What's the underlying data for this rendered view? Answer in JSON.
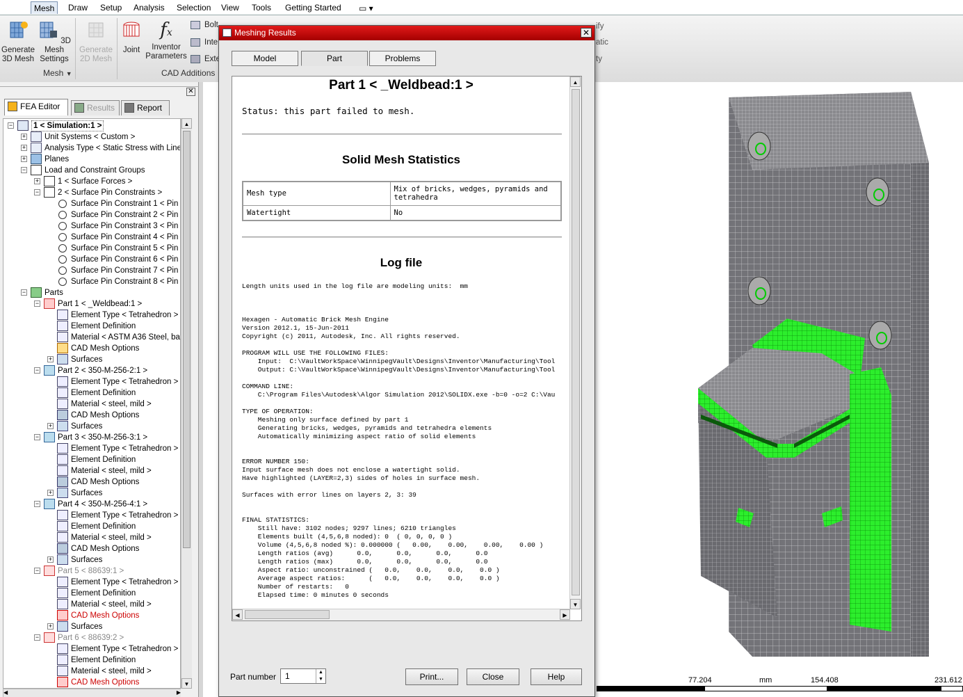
{
  "menu": {
    "items": [
      "Mesh",
      "Draw",
      "Setup",
      "Analysis",
      "Selection",
      "View",
      "Tools",
      "Getting Started"
    ],
    "active": "Mesh"
  },
  "ribbon": {
    "generate_3d_mesh": "Generate\n3D Mesh",
    "mesh_settings_3d": "3D Mesh\nSettings",
    "generate_2d_mesh": "Generate\n2D Mesh",
    "joint": "Joint",
    "inventor_parameters": "Inventor\nParameters",
    "group_mesh": "Mesh",
    "group_cad_additions": "CAD Additions",
    "bolt": "Bolt",
    "inte": "Inte",
    "exte": "Exte",
    "right_frag1": "ify",
    "right_frag2": "atic",
    "right_frag3": "ty"
  },
  "left_pane": {
    "tabs": [
      "FEA Editor",
      "Results",
      "Report"
    ],
    "active_tab": "FEA Editor",
    "tree": [
      {
        "level": 0,
        "exp": "-",
        "icon": "sim",
        "label": "1 < Simulation:1 >",
        "style": "bold"
      },
      {
        "level": 1,
        "exp": "+",
        "icon": "units",
        "label": "Unit Systems < Custom >"
      },
      {
        "level": 1,
        "exp": "+",
        "icon": "analysis",
        "label": "Analysis Type < Static Stress with Linear"
      },
      {
        "level": 1,
        "exp": "+",
        "icon": "planes",
        "label": "Planes"
      },
      {
        "level": 1,
        "exp": "-",
        "icon": "load",
        "label": "Load and Constraint Groups"
      },
      {
        "level": 2,
        "exp": "+",
        "icon": "load",
        "label": "1 < Surface Forces >"
      },
      {
        "level": 2,
        "exp": "-",
        "icon": "load",
        "label": "2 < Surface Pin Constraints >"
      },
      {
        "level": 3,
        "exp": "",
        "icon": "pin",
        "label": "Surface Pin Constraint 1 < Pin Co"
      },
      {
        "level": 3,
        "exp": "",
        "icon": "pin",
        "label": "Surface Pin Constraint 2 < Pin Co"
      },
      {
        "level": 3,
        "exp": "",
        "icon": "pin",
        "label": "Surface Pin Constraint 3 < Pin Co"
      },
      {
        "level": 3,
        "exp": "",
        "icon": "pin",
        "label": "Surface Pin Constraint 4 < Pin Co"
      },
      {
        "level": 3,
        "exp": "",
        "icon": "pin",
        "label": "Surface Pin Constraint 5 < Pin Co"
      },
      {
        "level": 3,
        "exp": "",
        "icon": "pin",
        "label": "Surface Pin Constraint 6 < Pin Co"
      },
      {
        "level": 3,
        "exp": "",
        "icon": "pin",
        "label": "Surface Pin Constraint 7 < Pin Co"
      },
      {
        "level": 3,
        "exp": "",
        "icon": "pin",
        "label": "Surface Pin Constraint 8 < Pin Co"
      },
      {
        "level": 1,
        "exp": "-",
        "icon": "parts",
        "label": "Parts"
      },
      {
        "level": 2,
        "exp": "-",
        "icon": "partwarn",
        "label": "Part 1 < _Weldbead:1 >"
      },
      {
        "level": 3,
        "exp": "",
        "icon": "doc",
        "label": "Element Type < Tetrahedron >"
      },
      {
        "level": 3,
        "exp": "",
        "icon": "doc",
        "label": "Element Definition"
      },
      {
        "level": 3,
        "exp": "",
        "icon": "doc",
        "label": "Material < ASTM A36 Steel, bar"
      },
      {
        "level": 3,
        "exp": "",
        "icon": "meshwarn",
        "label": "CAD Mesh Options"
      },
      {
        "level": 3,
        "exp": "+",
        "icon": "surf",
        "label": "Surfaces"
      },
      {
        "level": 2,
        "exp": "-",
        "icon": "part",
        "label": "Part 2 < 350-M-256-2:1 >"
      },
      {
        "level": 3,
        "exp": "",
        "icon": "doc",
        "label": "Element Type < Tetrahedron >"
      },
      {
        "level": 3,
        "exp": "",
        "icon": "doc",
        "label": "Element Definition"
      },
      {
        "level": 3,
        "exp": "",
        "icon": "doc",
        "label": "Material < steel, mild >"
      },
      {
        "level": 3,
        "exp": "",
        "icon": "mesh",
        "label": "CAD Mesh Options"
      },
      {
        "level": 3,
        "exp": "+",
        "icon": "surf",
        "label": "Surfaces"
      },
      {
        "level": 2,
        "exp": "-",
        "icon": "part",
        "label": "Part 3 < 350-M-256-3:1 >"
      },
      {
        "level": 3,
        "exp": "",
        "icon": "doc",
        "label": "Element Type < Tetrahedron >"
      },
      {
        "level": 3,
        "exp": "",
        "icon": "doc",
        "label": "Element Definition"
      },
      {
        "level": 3,
        "exp": "",
        "icon": "doc",
        "label": "Material < steel, mild >"
      },
      {
        "level": 3,
        "exp": "",
        "icon": "mesh",
        "label": "CAD Mesh Options"
      },
      {
        "level": 3,
        "exp": "+",
        "icon": "surf",
        "label": "Surfaces"
      },
      {
        "level": 2,
        "exp": "-",
        "icon": "part",
        "label": "Part 4 < 350-M-256-4:1 >"
      },
      {
        "level": 3,
        "exp": "",
        "icon": "doc",
        "label": "Element Type < Tetrahedron >"
      },
      {
        "level": 3,
        "exp": "",
        "icon": "doc",
        "label": "Element Definition"
      },
      {
        "level": 3,
        "exp": "",
        "icon": "doc",
        "label": "Material < steel, mild >"
      },
      {
        "level": 3,
        "exp": "",
        "icon": "mesh",
        "label": "CAD Mesh Options"
      },
      {
        "level": 3,
        "exp": "+",
        "icon": "surf",
        "label": "Surfaces"
      },
      {
        "level": 2,
        "exp": "-",
        "icon": "partx",
        "label": "Part 5 < 88639:1 >",
        "style": "gray"
      },
      {
        "level": 3,
        "exp": "",
        "icon": "doc",
        "label": "Element Type < Tetrahedron >"
      },
      {
        "level": 3,
        "exp": "",
        "icon": "doc",
        "label": "Element Definition"
      },
      {
        "level": 3,
        "exp": "",
        "icon": "doc",
        "label": "Material < steel, mild >"
      },
      {
        "level": 3,
        "exp": "",
        "icon": "meshx",
        "label": "CAD Mesh Options",
        "style": "red"
      },
      {
        "level": 3,
        "exp": "+",
        "icon": "surf",
        "label": "Surfaces"
      },
      {
        "level": 2,
        "exp": "-",
        "icon": "partx",
        "label": "Part 6 < 88639:2 >",
        "style": "gray"
      },
      {
        "level": 3,
        "exp": "",
        "icon": "doc",
        "label": "Element Type < Tetrahedron >"
      },
      {
        "level": 3,
        "exp": "",
        "icon": "doc",
        "label": "Element Definition"
      },
      {
        "level": 3,
        "exp": "",
        "icon": "doc",
        "label": "Material < steel, mild >"
      },
      {
        "level": 3,
        "exp": "",
        "icon": "meshx",
        "label": "CAD Mesh Options",
        "style": "red"
      }
    ]
  },
  "dialog": {
    "title": "Meshing Results",
    "close": "✕",
    "tabs": [
      "Model",
      "Part",
      "Problems"
    ],
    "active_tab": "Part",
    "report": {
      "heading": "Part 1 < _Weldbead:1 >",
      "status": "Status: this part failed to mesh.",
      "stats_heading": "Solid Mesh Statistics",
      "stats": [
        {
          "key": "Mesh type",
          "value": "Mix of bricks, wedges, pyramids and tetrahedra"
        },
        {
          "key": "Watertight",
          "value": "No"
        }
      ],
      "log_heading": "Log file",
      "log_text": "Length units used in the log file are modeling units:  mm\n\n\n\nHexagen - Automatic Brick Mesh Engine\nVersion 2012.1, 15-Jun-2011\nCopyright (c) 2011, Autodesk, Inc. All rights reserved.\n\nPROGRAM WILL USE THE FOLLOWING FILES:\n    Input:  C:\\VaultWorkSpace\\WinnipegVault\\Designs\\Inventor\\Manufacturing\\Tool\n    Output: C:\\VaultWorkSpace\\WinnipegVault\\Designs\\Inventor\\Manufacturing\\Tool\n\nCOMMAND LINE:\n    C:\\Program Files\\Autodesk\\Algor Simulation 2012\\SOLIDX.exe -b=0 -o=2 C:\\Vau\n\nTYPE OF OPERATION:\n    Meshing only surface defined by part 1\n    Generating bricks, wedges, pyramids and tetrahedra elements\n    Automatically minimizing aspect ratio of solid elements\n\n\nERROR NUMBER 150:\nInput surface mesh does not enclose a watertight solid.\nHave highlighted (LAYER=2,3) sides of holes in surface mesh.\n\nSurfaces with error lines on layers 2, 3: 39\n\n\nFINAL STATISTICS:\n    Still have: 3102 nodes; 9297 lines; 6210 triangles\n    Elements built (4,5,6,8 noded): 0  ( 0, 0, 0, 0 )\n    Volume (4,5,6,8 noded %): 0.000000 (   0.00,    0.00,    0.00,    0.00 )\n    Length ratios (avg)      0.0,      0.0,      0.0,      0.0\n    Length ratios (max)      0.0,      0.0,      0.0,      0.0\n    Aspect ratio: unconstrained (   0.0,    0.0,    0.0,    0.0 )\n    Average aspect ratios:      (   0.0,    0.0,    0.0,    0.0 )\n    Number of restarts:   0\n    Elapsed time: 0 minutes 0 seconds"
    },
    "part_number_label": "Part number",
    "part_number_value": "1",
    "print_label": "Print...",
    "close_label": "Close",
    "help_label": "Help"
  },
  "viewport": {
    "ruler": {
      "tick1": "77.204",
      "unit": "mm",
      "tick2": "154.408",
      "tick3": "231.612"
    },
    "highlight_color": "#22ee22",
    "mesh_color": "#6e6e72"
  }
}
